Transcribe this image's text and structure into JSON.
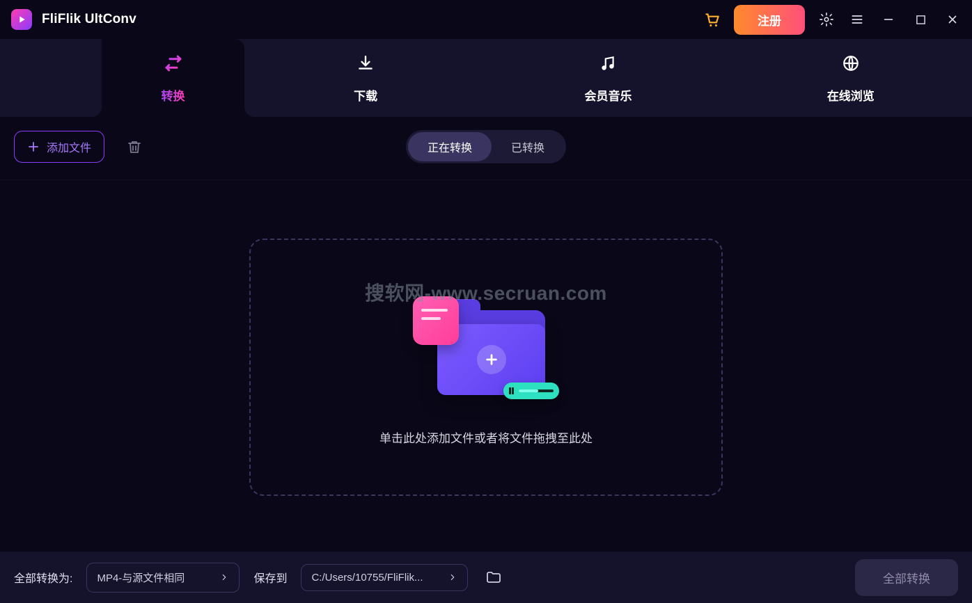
{
  "app": {
    "title": "FliFlik UltConv"
  },
  "titlebar": {
    "register_label": "注册"
  },
  "tabs": [
    {
      "label": "转换",
      "icon": "convert",
      "active": true
    },
    {
      "label": "下载",
      "icon": "download",
      "active": false
    },
    {
      "label": "会员音乐",
      "icon": "music",
      "active": false
    },
    {
      "label": "在线浏览",
      "icon": "globe",
      "active": false
    }
  ],
  "toolbar": {
    "add_file_label": "添加文件"
  },
  "status_tabs": {
    "converting": "正在转换",
    "converted": "已转换",
    "active": "converting"
  },
  "drop_zone": {
    "text": "单击此处添加文件或者将文件拖拽至此处"
  },
  "watermark": "搜软网-www.secruan.com",
  "bottom_bar": {
    "convert_to_label": "全部转换为:",
    "format_value": "MP4-与源文件相同",
    "save_to_label": "保存到",
    "path_value": "C:/Users/10755/FliFlik...",
    "convert_all_label": "全部转换"
  }
}
